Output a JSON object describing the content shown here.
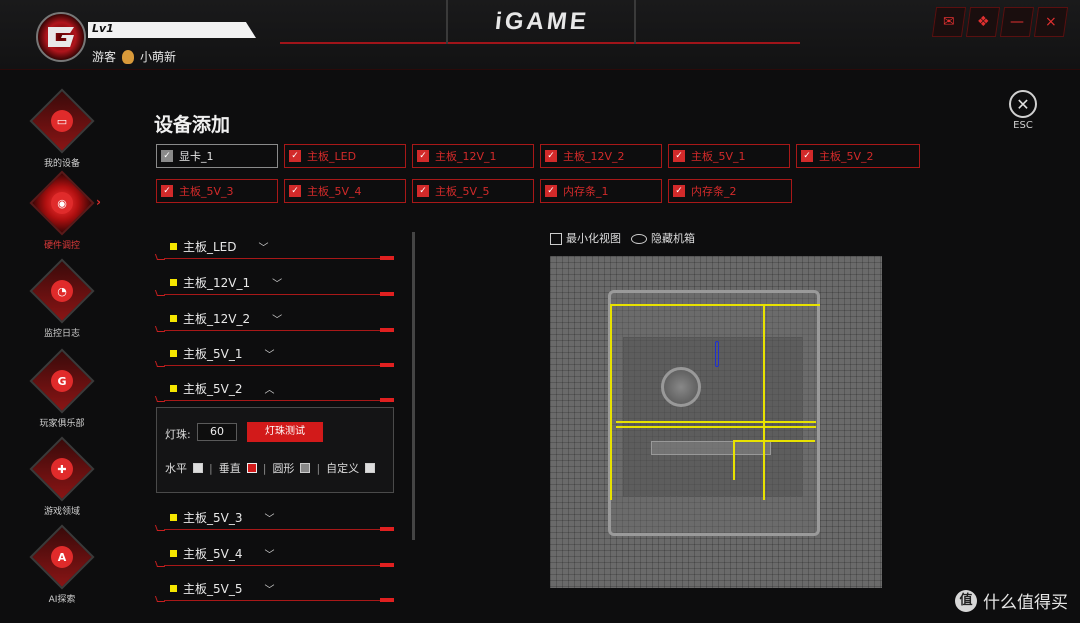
{
  "app": {
    "logo": "iGAME"
  },
  "user": {
    "level": "Lv1",
    "role": "游客",
    "name": "小萌新"
  },
  "window_buttons": [
    {
      "icon": "notification-icon"
    },
    {
      "icon": "skin-icon"
    },
    {
      "icon": "minimize-icon",
      "glyph": "—"
    },
    {
      "icon": "close-icon",
      "glyph": "×"
    }
  ],
  "sidebar": {
    "items": [
      {
        "label": "我的设备",
        "icon": "monitor-icon"
      },
      {
        "label": "硬件调控",
        "icon": "control-icon",
        "active": true
      },
      {
        "label": "监控日志",
        "icon": "gauge-icon"
      },
      {
        "label": "玩家俱乐部",
        "icon": "club-logo-icon"
      },
      {
        "label": "游戏领域",
        "icon": "gamepad-icon"
      },
      {
        "label": "AI探索",
        "icon": "ai-icon"
      }
    ]
  },
  "main": {
    "title": "设备添加",
    "esc_label": "ESC",
    "devices": [
      "显卡_1",
      "主板_LED",
      "主板_12V_1",
      "主板_12V_2",
      "主板_5V_1",
      "主板_5V_2",
      "主板_5V_3",
      "主板_5V_4",
      "主板_5V_5",
      "内存条_1",
      "内存条_2"
    ],
    "strips": [
      "主板_LED",
      "主板_12V_1",
      "主板_12V_2",
      "主板_5V_1",
      "主板_5V_2",
      "主板_5V_3",
      "主板_5V_4",
      "主板_5V_5"
    ],
    "expanded_panel": {
      "beads_label": "灯珠:",
      "beads_value": "60",
      "test_button": "灯珠测试",
      "modes": [
        "水平",
        "垂直",
        "圆形",
        "自定义"
      ]
    },
    "view": {
      "minimize": "最小化视图",
      "hide_case": "隐藏机箱"
    }
  },
  "watermark": {
    "text": "什么值得买",
    "badge": "值"
  },
  "colors": {
    "accent": "#d21a1a",
    "strip_marker": "#f5e600",
    "background": "#0d0d0e"
  }
}
